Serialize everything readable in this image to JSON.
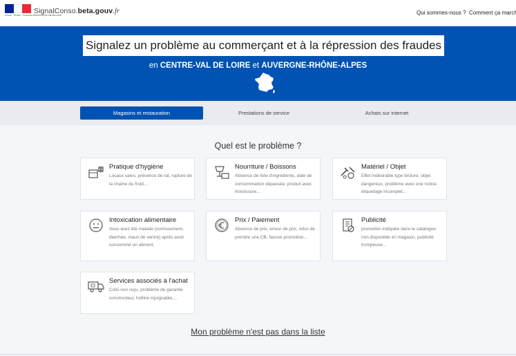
{
  "header": {
    "rf_logo_text": "Liberté · Égalité · Fraternité RÉPUBLIQUE FRANÇAISE",
    "brand_pre": "SignalConso.",
    "brand_bold": "beta.gouv",
    "brand_post": ".fr",
    "nav": [
      "Qui sommes-nous ?",
      "Comment ça marche"
    ]
  },
  "hero": {
    "title": "Signalez un problème au commerçant et à la répression des fraudes",
    "sub_prefix": "en",
    "region1": "CENTRE-VAL DE LOIRE",
    "sub_mid": "et",
    "region2": "AUVERGNE-RHÔNE-ALPES",
    "icon": "france-map-icon"
  },
  "tabs": [
    {
      "label": "Magasins et restauration",
      "active": true
    },
    {
      "label": "Prestations de service",
      "active": false
    },
    {
      "label": "Achats sur internet",
      "active": false
    }
  ],
  "question": "Quel est le problème ?",
  "cards": [
    {
      "title": "Pratique d'hygiène",
      "desc": "Locaux sales, présence de rat, rupture de la chaîne du froid...",
      "icon": "hygiene-icon"
    },
    {
      "title": "Nourriture / Boissons",
      "desc": "Absence de liste d'ingrédients, date de consommation dépassée, produit avec moisissure...",
      "icon": "food-drink-icon"
    },
    {
      "title": "Matériel / Objet",
      "desc": "Effet indésirable type brûlure, objet dangereux, problème avec une notice, étiquetage incomplet...",
      "icon": "tools-icon"
    },
    {
      "title": "Intoxication alimentaire",
      "desc": "Vous avez été malade (vomissement, diarrhée, maux de ventre) après avoir consommé un aliment.",
      "icon": "sick-face-icon"
    },
    {
      "title": "Prix / Paiement",
      "desc": "Absence de prix, erreur de prix, refus de prendre une CB, fausse promotion...",
      "icon": "euro-coin-icon"
    },
    {
      "title": "Publicité",
      "desc": "promotion indiquée dans le catalogue non disponible en magasin, publicité trompeuse...",
      "icon": "advert-icon"
    },
    {
      "title": "Services associés à l'achat",
      "desc": "Colis non reçu, problème de garantie constructeur, hotline injoignable,...",
      "icon": "delivery-truck-icon"
    }
  ],
  "other_link": "Mon problème n'est pas dans la liste",
  "colors": {
    "primary": "#0053b3",
    "flag_blue": "#002395",
    "flag_red": "#ed2939"
  }
}
